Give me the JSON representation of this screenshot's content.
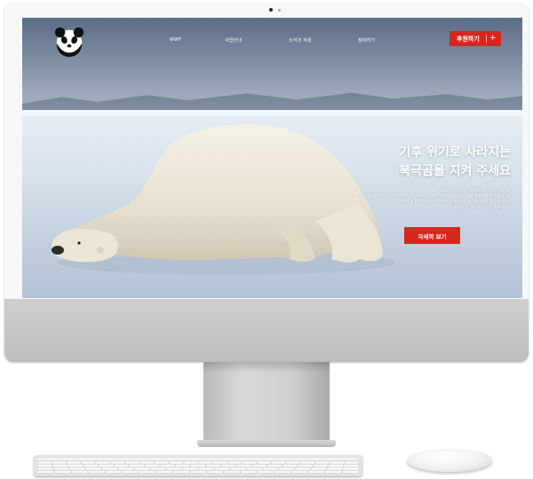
{
  "nav": {
    "links": [
      "WWF",
      "사업안내",
      "소식과 자원",
      "참여하기"
    ],
    "donate_label": "후원하기",
    "donate_plus": "+"
  },
  "hero": {
    "title_lines": [
      "기후 위기로 사라지는",
      "북극곰을 지켜 주세요"
    ],
    "body_lines": [
      "2050년, 북극곰은 공전의 사라질 지 모릅니다",
      "기후위기를 대처하는 일은 북극곰을 지키는 것 뿐만 아니라 우리의 문제를 해결하기 위한 일입니다",
      "WWF의 활동은 전세계 600만 후원자들과 당신의 참여로 이루어집니다",
      "바로 지금, 당신의 행동이 필요합니다"
    ],
    "more_label": "자세히 보기"
  },
  "colors": {
    "accent": "#d7261e",
    "text_on_image": "#ffffff"
  },
  "icons": {
    "logo": "panda-logo-icon",
    "donate": "plus-icon"
  }
}
